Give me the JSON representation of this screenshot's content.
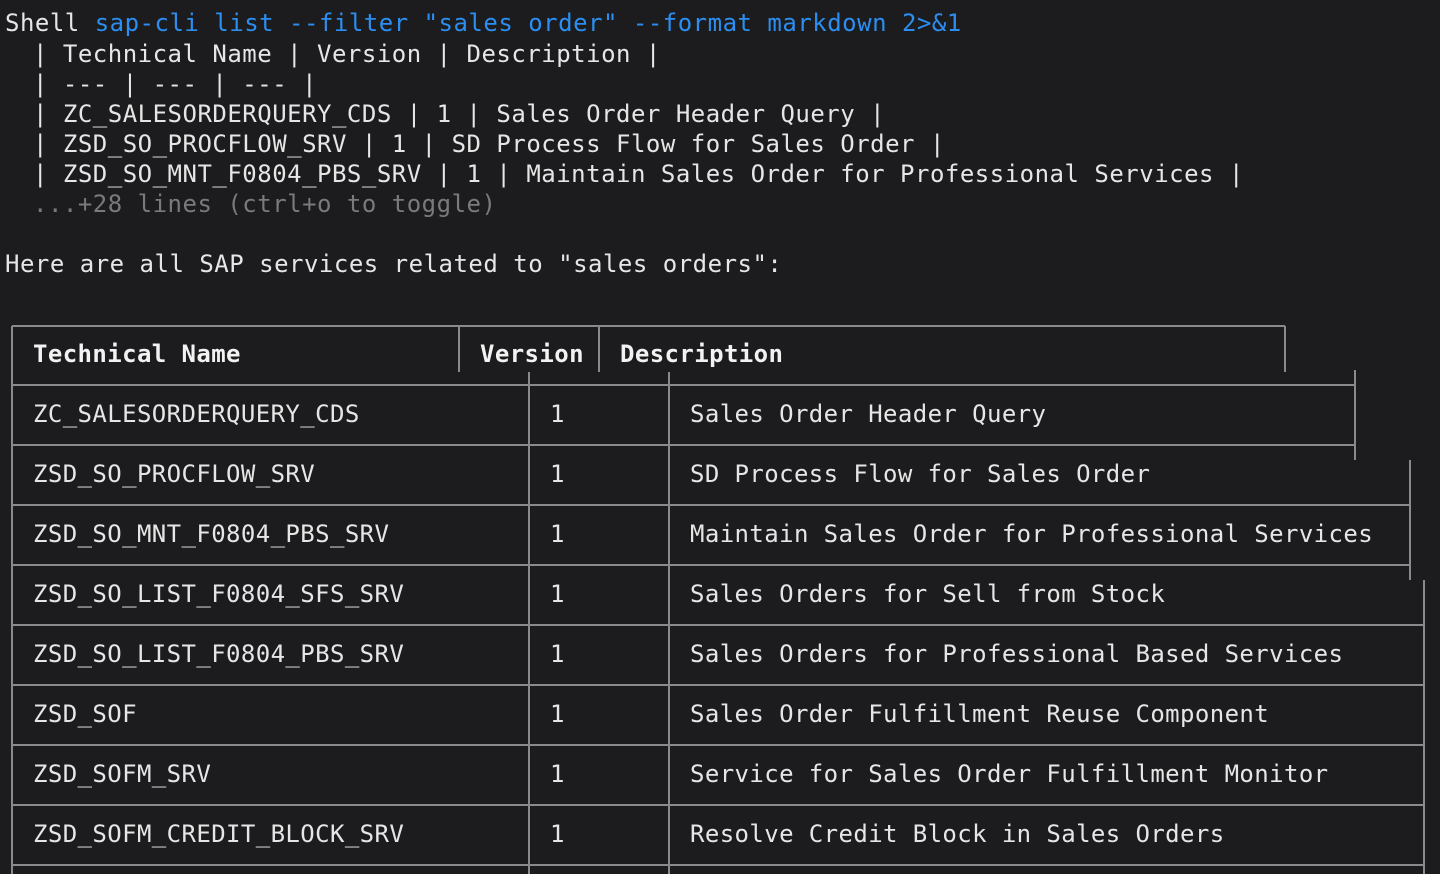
{
  "shell": {
    "label": "Shell",
    "command": "sap-cli list --filter \"sales order\" --format markdown 2>&1",
    "raw_output": [
      "| Technical Name | Version | Description |",
      "| --- | --- | --- |",
      "| ZC_SALESORDERQUERY_CDS | 1 | Sales Order Header Query |",
      "| ZSD_SO_PROCFLOW_SRV | 1 | SD Process Flow for Sales Order |",
      "| ZSD_SO_MNT_F0804_PBS_SRV | 1 | Maintain Sales Order for Professional Services |"
    ],
    "collapsed_hint": "...+28 lines (ctrl+o to toggle)"
  },
  "response": {
    "intro": "Here are all SAP services related to \"sales orders\":"
  },
  "table": {
    "headers": [
      "Technical Name",
      "Version",
      "Description"
    ],
    "rows": [
      [
        "ZC_SALESORDERQUERY_CDS",
        "1",
        "Sales Order Header Query"
      ],
      [
        "ZSD_SO_PROCFLOW_SRV",
        "1",
        "SD Process Flow for Sales Order"
      ],
      [
        "ZSD_SO_MNT_F0804_PBS_SRV",
        "1",
        "Maintain Sales Order for Professional Services"
      ],
      [
        "ZSD_SO_LIST_F0804_SFS_SRV",
        "1",
        "Sales Orders for Sell from Stock"
      ],
      [
        "ZSD_SO_LIST_F0804_PBS_SRV",
        "1",
        "Sales Orders for Professional Based Services"
      ],
      [
        "ZSD_SOF",
        "1",
        "Sales Order Fulfillment Reuse Component"
      ],
      [
        "ZSD_SOFM_SRV",
        "1",
        "Service for Sales Order Fulfillment Monitor"
      ],
      [
        "ZSD_SOFM_CREDIT_BLOCK_SRV",
        "1",
        "Resolve Credit Block in Sales Orders"
      ]
    ]
  },
  "colors": {
    "background": "#1c1c1e",
    "text": "#e6e6e6",
    "command": "#2b8ef0",
    "dim": "#7a7a7e",
    "border": "#8a8a8e"
  }
}
